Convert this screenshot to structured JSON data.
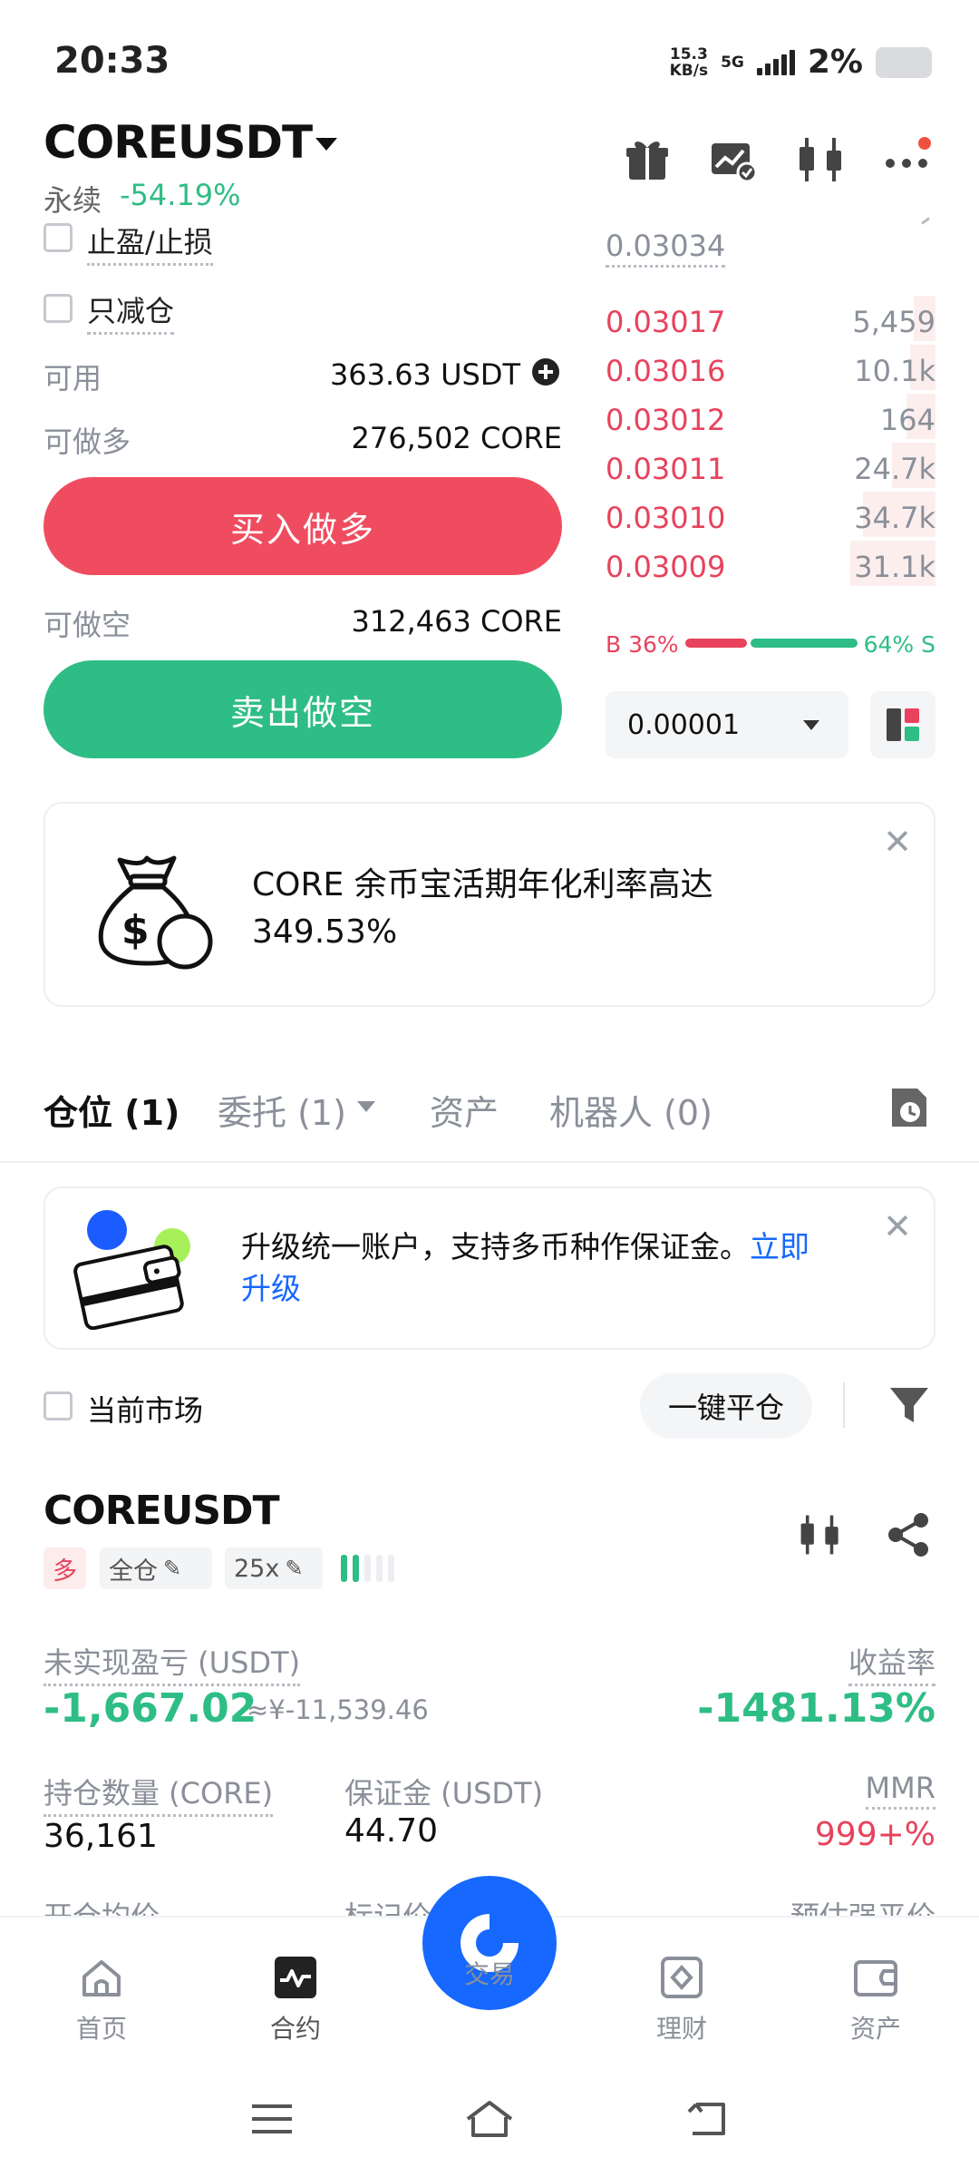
{
  "status_bar": {
    "time": "20:33",
    "net_speed_value": "15.3",
    "net_speed_unit": "KB/s",
    "network": "5G",
    "battery": "2%"
  },
  "header": {
    "pair": "COREUSDT",
    "contract_type": "永续",
    "change": "-54.19%"
  },
  "form": {
    "tp_sl_label": "止盈/止损",
    "reduce_only_label": "只减仓",
    "available_label": "可用",
    "available_value": "363.63 USDT",
    "can_long_label": "可做多",
    "can_long_value": "276,502 CORE",
    "buy_button": "买入做多",
    "can_short_label": "可做空",
    "can_short_value": "312,463 CORE",
    "sell_button": "卖出做空"
  },
  "order_book": {
    "last_price": "0.03034",
    "asks": [
      {
        "price": "0.03017",
        "qty": "5,459",
        "depth": 0.12
      },
      {
        "price": "0.03016",
        "qty": "10.1k",
        "depth": 0.14
      },
      {
        "price": "0.03012",
        "qty": "164",
        "depth": 0.16
      },
      {
        "price": "0.03011",
        "qty": "24.7k",
        "depth": 0.24
      },
      {
        "price": "0.03010",
        "qty": "34.7k",
        "depth": 0.4
      },
      {
        "price": "0.03009",
        "qty": "31.1k",
        "depth": 0.47
      }
    ],
    "buy_ratio": "B 36%",
    "sell_ratio": "64% S",
    "buy_fraction": 0.36,
    "precision": "0.00001"
  },
  "promo": {
    "text_line1": "CORE 余币宝活期年化利率高达",
    "text_line2": "349.53%"
  },
  "tabs": [
    {
      "label": "仓位 (1)"
    },
    {
      "label": "委托 (1)"
    },
    {
      "label": "资产"
    },
    {
      "label": "机器人 (0)"
    }
  ],
  "upgrade_banner": {
    "text": "升级统一账户，支持多币种作保证金。",
    "link_part1": "立即",
    "link_part2": "升级"
  },
  "filter": {
    "current_market_label": "当前市场",
    "close_all_button": "一键平仓"
  },
  "position": {
    "symbol": "COREUSDT",
    "side_tag": "多",
    "margin_mode_tag": "全仓",
    "leverage_tag": "25x",
    "pnl_label": "未实现盈亏 (USDT)",
    "pnl_value": "-1,667.02",
    "pnl_cny": "≈¥-11,539.46",
    "roe_label": "收益率",
    "roe_value": "-1481.13%",
    "size_label": "持仓数量 (CORE)",
    "size_value": "36,161",
    "margin_label": "保证金 (USDT)",
    "margin_value": "44.70",
    "mmr_label": "MMR",
    "mmr_value": "999+%",
    "entry_label": "开仓均价",
    "mark_label": "标记价",
    "liq_label": "预估强平价"
  },
  "bottom_nav": {
    "home": "首页",
    "futures": "合约",
    "trade": "交易",
    "earn": "理财",
    "assets": "资产"
  },
  "colors": {
    "green": "#2ebd85",
    "red": "#e8425c",
    "buy_button": "#f04c5f",
    "sell_button": "#2ebd85",
    "brand_blue": "#1668ff"
  }
}
